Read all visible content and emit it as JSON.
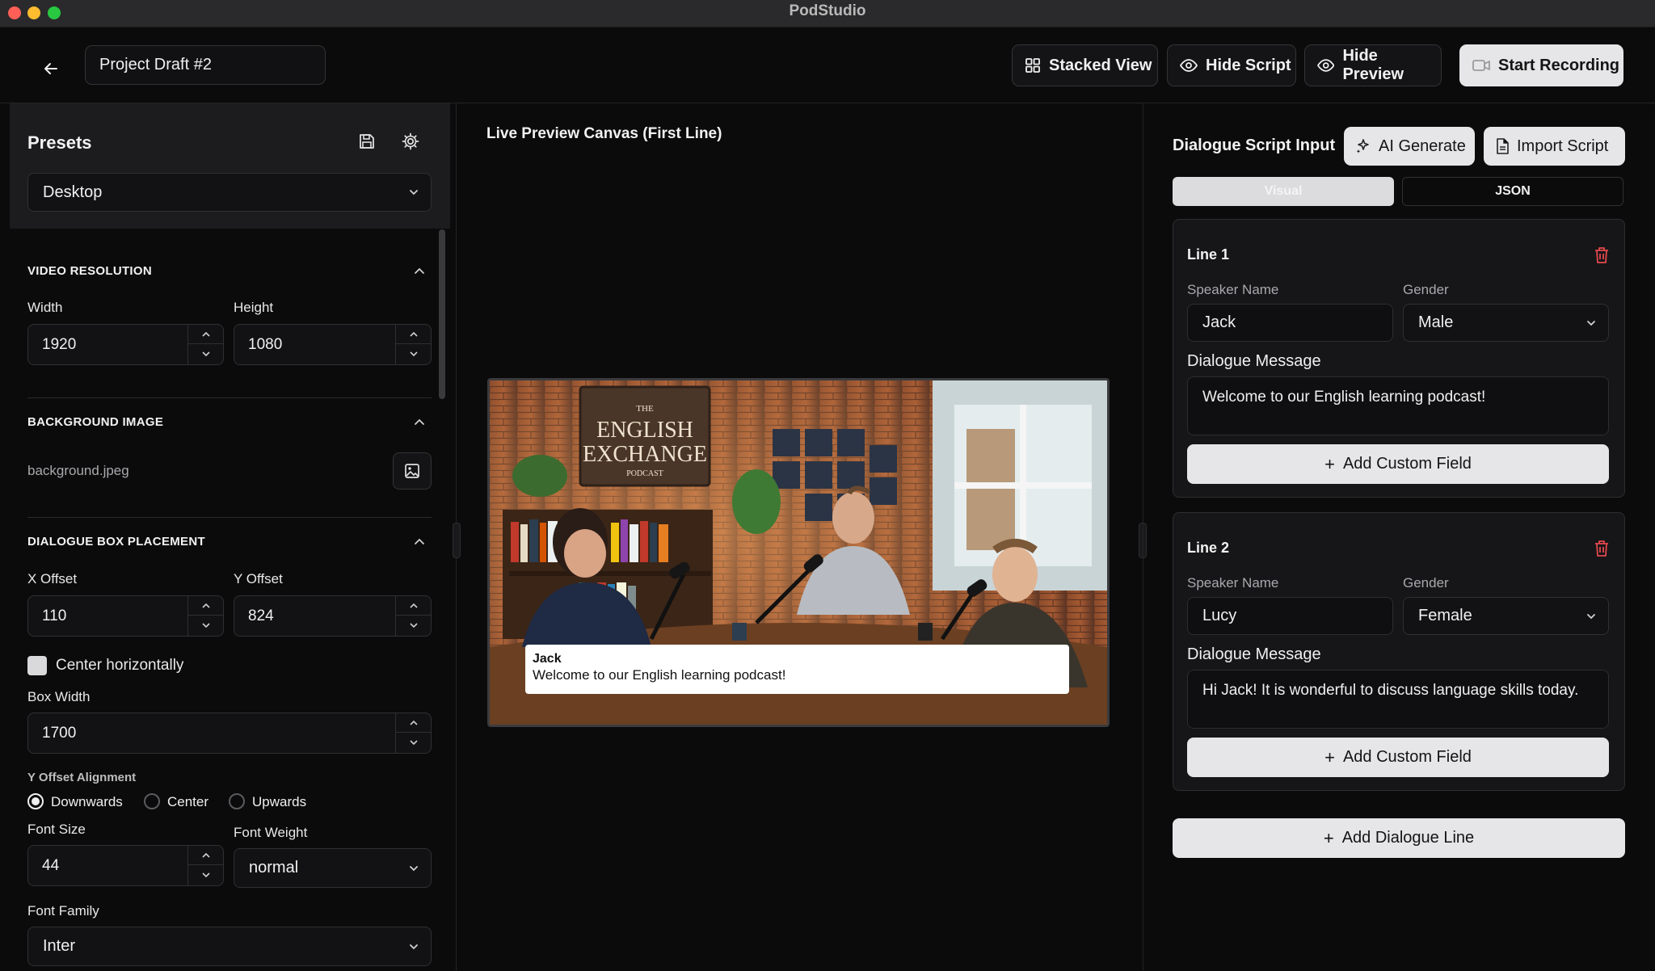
{
  "app": {
    "title": "PodStudio"
  },
  "toolbar": {
    "project_name": "Project Draft #2",
    "stacked_view": "Stacked View",
    "hide_script": "Hide Script",
    "hide_preview": "Hide Preview",
    "start_recording": "Start Recording"
  },
  "presets": {
    "title": "Presets",
    "selected": "Desktop"
  },
  "video_resolution": {
    "title": "VIDEO RESOLUTION",
    "width_label": "Width",
    "width": "1920",
    "height_label": "Height",
    "height": "1080"
  },
  "background_image": {
    "title": "BACKGROUND IMAGE",
    "filename": "background.jpeg"
  },
  "dialogue_box": {
    "title": "DIALOGUE BOX PLACEMENT",
    "x_label": "X Offset",
    "x": "110",
    "y_label": "Y Offset",
    "y": "824",
    "center_label": "Center horizontally",
    "center_checked": true,
    "box_width_label": "Box Width",
    "box_width": "1700",
    "y_align_label": "Y Offset Alignment",
    "align_options": [
      "Downwards",
      "Center",
      "Upwards"
    ],
    "align_selected": "Downwards",
    "font_size_label": "Font Size",
    "font_size": "44",
    "font_weight_label": "Font Weight",
    "font_weight": "normal",
    "font_family_label": "Font Family",
    "font_family": "Inter"
  },
  "preview": {
    "title": "Live Preview Canvas (First Line)",
    "sign_small_top": "THE",
    "sign_line1": "ENGLISH",
    "sign_line2": "EXCHANGE",
    "sign_small_bottom": "PODCAST",
    "speaker": "Jack",
    "message": "Welcome to our English learning podcast!"
  },
  "script": {
    "title": "Dialogue Script Input",
    "ai_generate": "AI Generate",
    "import_script": "Import Script",
    "tab_visual": "Visual",
    "tab_json": "JSON",
    "speaker_label": "Speaker Name",
    "gender_label": "Gender",
    "message_label": "Dialogue Message",
    "add_custom_field": "Add Custom Field",
    "add_line": "Add Dialogue Line",
    "lines": [
      {
        "title": "Line 1",
        "speaker": "Jack",
        "gender": "Male",
        "message": "Welcome to our English learning podcast!"
      },
      {
        "title": "Line 2",
        "speaker": "Lucy",
        "gender": "Female",
        "message": "Hi Jack! It is wonderful to discuss language skills today."
      }
    ]
  },
  "colors": {
    "accent": "#e6e6e8",
    "danger": "#e5484d",
    "background": "#0b0b0c",
    "panel": "#1c1c1e"
  }
}
